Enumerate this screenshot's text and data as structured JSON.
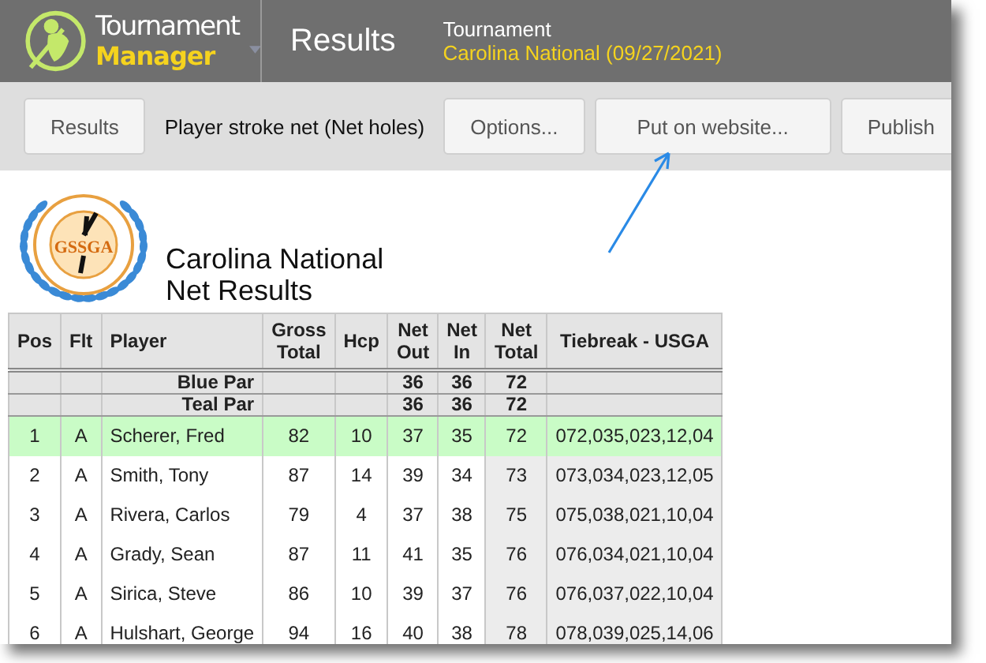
{
  "app": {
    "name_top": "Tournament",
    "name_bottom": "Manager",
    "section": "Results",
    "tournament_label": "Tournament",
    "tournament_name": "Carolina National (09/27/2021)"
  },
  "toolbar": {
    "results_button": "Results",
    "report_name": "Player stroke net (Net holes)",
    "buttons": [
      "Options...",
      "Put on website...",
      "Publish"
    ]
  },
  "report": {
    "logo_initials": "GSSGA",
    "title_lines": [
      "Carolina National",
      "Net Results"
    ]
  },
  "table": {
    "columns": [
      {
        "label": "Pos",
        "shaded": false
      },
      {
        "label": "Flt",
        "shaded": false
      },
      {
        "label": "Player",
        "shaded": false
      },
      {
        "label": "Gross Total",
        "shaded": false
      },
      {
        "label": "Hcp",
        "shaded": false
      },
      {
        "label": "Net Out",
        "shaded": false
      },
      {
        "label": "Net In",
        "shaded": false
      },
      {
        "label": "Net Total",
        "shaded": true
      },
      {
        "label": "Tiebreak - USGA",
        "shaded": true
      }
    ],
    "rows": [
      {
        "kind": "par",
        "selected": false,
        "cells": [
          "",
          "",
          "Blue Par",
          "",
          "",
          "36",
          "36",
          "72",
          ""
        ]
      },
      {
        "kind": "par",
        "selected": false,
        "cells": [
          "",
          "",
          "Teal Par",
          "",
          "",
          "36",
          "36",
          "72",
          ""
        ]
      },
      {
        "kind": "player",
        "selected": true,
        "cells": [
          "1",
          "A",
          "Scherer, Fred",
          "82",
          "10",
          "37",
          "35",
          "72",
          "072,035,023,12,04"
        ]
      },
      {
        "kind": "player",
        "selected": false,
        "cells": [
          "2",
          "A",
          "Smith, Tony",
          "87",
          "14",
          "39",
          "34",
          "73",
          "073,034,023,12,05"
        ]
      },
      {
        "kind": "player",
        "selected": false,
        "cells": [
          "3",
          "A",
          "Rivera, Carlos",
          "79",
          "4",
          "37",
          "38",
          "75",
          "075,038,021,10,04"
        ]
      },
      {
        "kind": "player",
        "selected": false,
        "cells": [
          "4",
          "A",
          "Grady, Sean",
          "87",
          "11",
          "41",
          "35",
          "76",
          "076,034,021,10,04"
        ]
      },
      {
        "kind": "player",
        "selected": false,
        "cells": [
          "5",
          "A",
          "Sirica, Steve",
          "86",
          "10",
          "39",
          "37",
          "76",
          "076,037,022,10,04"
        ]
      },
      {
        "kind": "player",
        "selected": false,
        "cells": [
          "6",
          "A",
          "Hulshart, George",
          "94",
          "16",
          "40",
          "38",
          "78",
          "078,039,025,14,06"
        ]
      }
    ]
  }
}
